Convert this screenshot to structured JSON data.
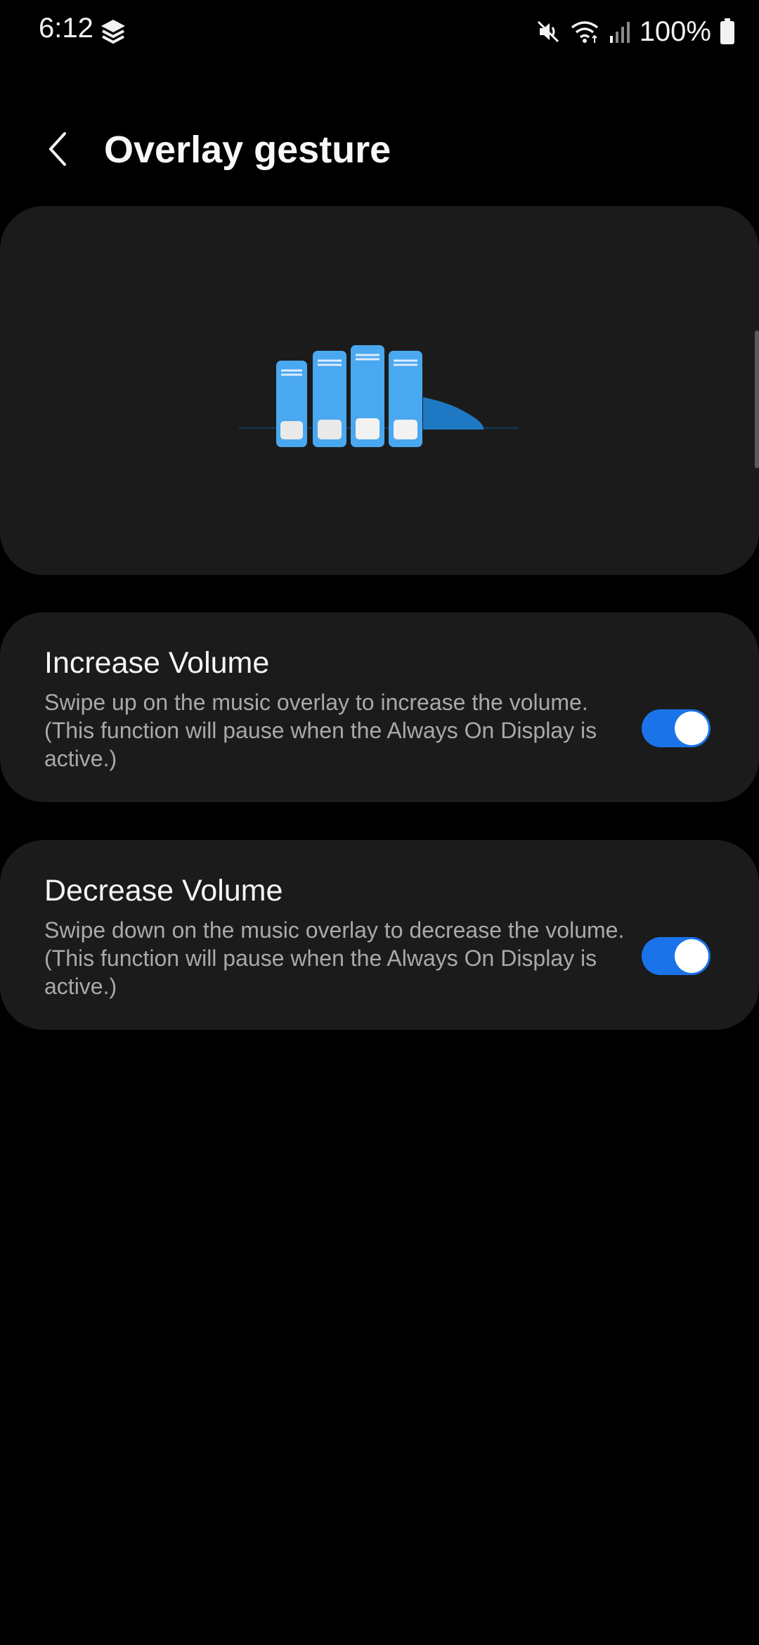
{
  "status_bar": {
    "time": "6:12",
    "battery": "100%",
    "icons": [
      "layers-icon",
      "mute-icon",
      "wifi-icon",
      "signal-icon",
      "battery-icon"
    ]
  },
  "header": {
    "title": "Overlay gesture",
    "back_icon": "chevron-left-icon"
  },
  "settings": [
    {
      "title": "Increase Volume",
      "description": "Swipe up on the music overlay to increase the volume. (This function will pause when the Always On Display is active.)",
      "enabled": true
    },
    {
      "title": "Decrease Volume",
      "description": "Swipe down on the music overlay to decrease the volume. (This function will pause when the Always On Display is active.)",
      "enabled": true
    }
  ],
  "colors": {
    "background": "#000000",
    "card": "#1b1b1b",
    "accent": "#1a73e8",
    "illustration_light": "#4aa8f0",
    "illustration_dark": "#1f78c4"
  }
}
